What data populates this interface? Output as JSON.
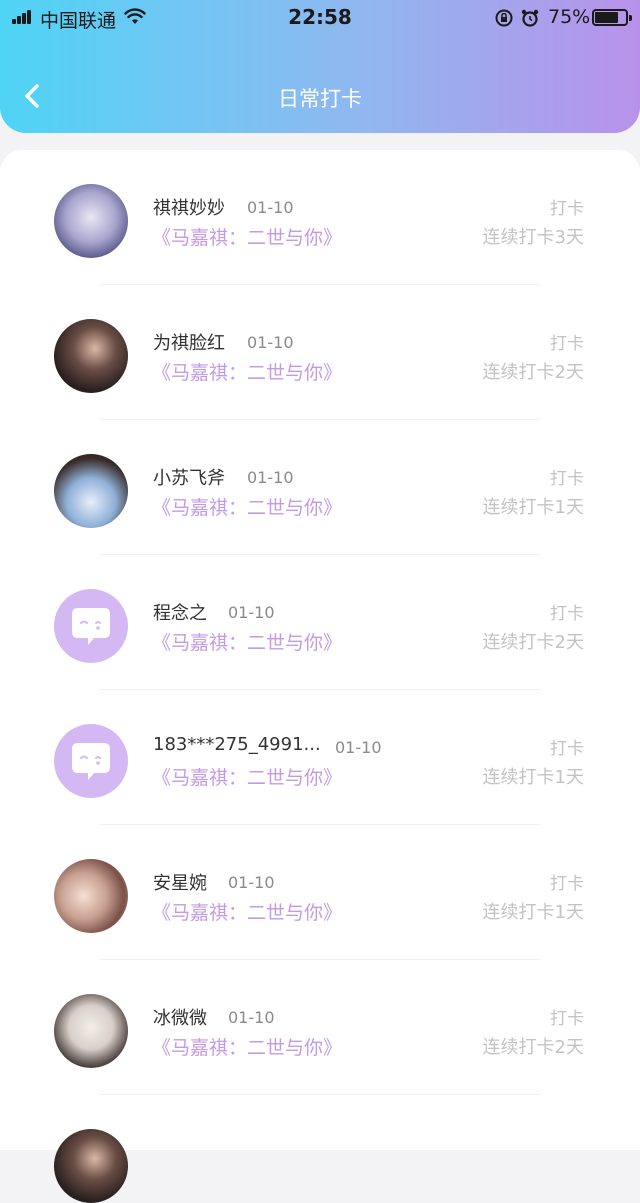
{
  "status_bar": {
    "carrier": "中国联通",
    "time": "22:58",
    "battery_percent": "75%",
    "battery_level": 0.75
  },
  "header": {
    "title": "日常打卡"
  },
  "colors": {
    "accent_purple": "#c49ae4",
    "header_gradient_start": "#4fd4f6",
    "header_gradient_end": "#b892ea"
  },
  "entries": [
    {
      "name": "祺祺妙妙",
      "date": "01-10",
      "topic": "《马嘉祺：二世与你》",
      "action": "打卡",
      "streak": "连续打卡3天",
      "avatar": "photo"
    },
    {
      "name": "为祺脸红",
      "date": "01-10",
      "topic": "《马嘉祺：二世与你》",
      "action": "打卡",
      "streak": "连续打卡2天",
      "avatar": "photo"
    },
    {
      "name": "小苏飞斧",
      "date": "01-10",
      "topic": "《马嘉祺：二世与你》",
      "action": "打卡",
      "streak": "连续打卡1天",
      "avatar": "photo"
    },
    {
      "name": "程念之",
      "date": "01-10",
      "topic": "《马嘉祺：二世与你》",
      "action": "打卡",
      "streak": "连续打卡2天",
      "avatar": "default-chat-icon"
    },
    {
      "name": "183***275_4991...",
      "date": "01-10",
      "topic": "《马嘉祺：二世与你》",
      "action": "打卡",
      "streak": "连续打卡1天",
      "avatar": "default-chat-icon"
    },
    {
      "name": "安星婉",
      "date": "01-10",
      "topic": "《马嘉祺：二世与你》",
      "action": "打卡",
      "streak": "连续打卡1天",
      "avatar": "photo"
    },
    {
      "name": "冰微微",
      "date": "01-10",
      "topic": "《马嘉祺：二世与你》",
      "action": "打卡",
      "streak": "连续打卡2天",
      "avatar": "photo"
    }
  ]
}
